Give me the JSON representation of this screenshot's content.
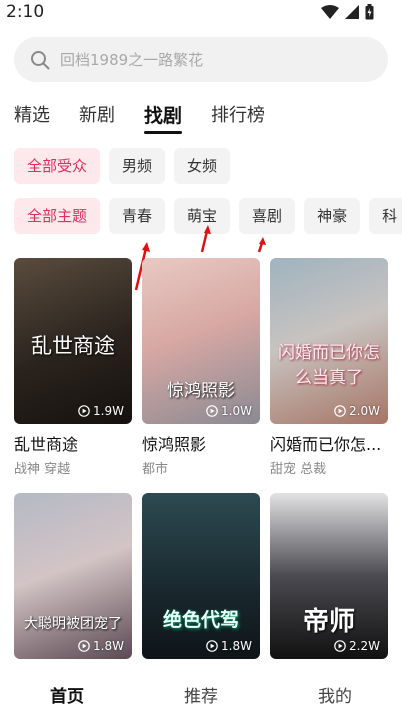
{
  "status": {
    "time": "2:10"
  },
  "search": {
    "placeholder": "回档1989之一路繁花"
  },
  "main_tabs": [
    "精选",
    "新剧",
    "找剧",
    "排行榜"
  ],
  "audience_filters": [
    "全部受众",
    "男频",
    "女频"
  ],
  "theme_filters": [
    "全部主题",
    "青春",
    "萌宝",
    "喜剧",
    "神豪",
    "科"
  ],
  "cards": [
    {
      "title": "乱世商途",
      "tags": "战神 穿越",
      "plays": "1.9W",
      "poster_text": "乱世商途"
    },
    {
      "title": "惊鸿照影",
      "tags": "都市",
      "plays": "1.0W",
      "poster_text": "惊鸿照影"
    },
    {
      "title": "闪婚而已你怎...",
      "tags": "甜宠 总裁",
      "plays": "2.0W",
      "poster_text": "闪婚而已你怎么当真了"
    },
    {
      "title": "",
      "tags": "",
      "plays": "1.8W",
      "poster_text": "大聪明被团宠了"
    },
    {
      "title": "",
      "tags": "",
      "plays": "1.8W",
      "poster_text": "绝色代驾"
    },
    {
      "title": "",
      "tags": "",
      "plays": "2.2W",
      "poster_text": "帝师"
    }
  ],
  "bottom_nav": [
    "首页",
    "推荐",
    "我的"
  ],
  "colors": {
    "accent": "#e0305a",
    "chip_active_bg": "#fde8ec",
    "annotation_arrow": "#e01010"
  }
}
